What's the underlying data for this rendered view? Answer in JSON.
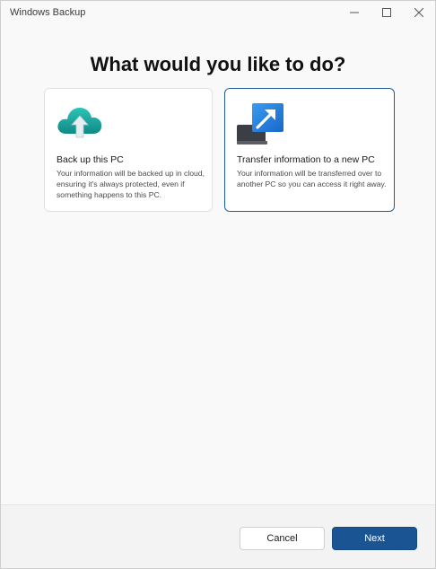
{
  "window": {
    "title": "Windows Backup"
  },
  "main": {
    "heading": "What would you like to do?",
    "options": [
      {
        "title": "Back up this PC",
        "description": "Your information will be backed up in cloud, ensuring it's always protected, even if something happens to this PC.",
        "icon": "cloud-upload-icon",
        "selected": false
      },
      {
        "title": "Transfer information to a new PC",
        "description": "Your information will be transferred over to another PC so you can access it right away.",
        "icon": "transfer-pc-icon",
        "selected": true
      }
    ]
  },
  "footer": {
    "cancel_label": "Cancel",
    "next_label": "Next"
  },
  "colors": {
    "accent": "#1a5493",
    "selected_border": "#1f5e99",
    "cloud": "#1aa39a"
  }
}
